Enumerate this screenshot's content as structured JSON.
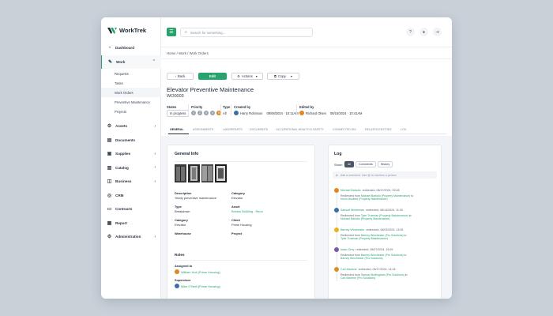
{
  "brand": {
    "name": "WorkTrek"
  },
  "sidebar": {
    "items": [
      {
        "label": "Dashboard",
        "icon": "dashboard-icon"
      },
      {
        "label": "Work",
        "icon": "wrench-icon"
      },
      {
        "label": "Assets",
        "icon": "gear-icon"
      },
      {
        "label": "Documents",
        "icon": "document-icon"
      },
      {
        "label": "Supplies",
        "icon": "box-icon"
      },
      {
        "label": "Catalog",
        "icon": "catalog-icon"
      },
      {
        "label": "Business",
        "icon": "briefcase-icon"
      },
      {
        "label": "CRM",
        "icon": "crm-icon"
      },
      {
        "label": "Contracts",
        "icon": "contract-icon"
      },
      {
        "label": "Report",
        "icon": "report-icon"
      },
      {
        "label": "Administration",
        "icon": "admin-icon"
      }
    ],
    "work_sub": [
      "Requests",
      "Tasks",
      "Work Orders",
      "Preventive Maintenance",
      "Projects"
    ]
  },
  "search": {
    "placeholder": "Search for something..."
  },
  "breadcrumb": "Home / Work / Work Orders",
  "toolbar": {
    "back": "Back",
    "edit": "Edit",
    "actions": "Actions",
    "copy": "Copy"
  },
  "page": {
    "title": "Elevator Preventive Maintenance",
    "code": "WO0003"
  },
  "meta": {
    "states_label": "States",
    "states_value": "In progress",
    "priority_label": "Priority",
    "priority_values": [
      "1",
      "2",
      "3",
      "4",
      "5"
    ],
    "priority_selected": 5,
    "type_label": "Type",
    "type_value": "All",
    "created_label": "Created by",
    "created_by": "Harry Robinson",
    "created_at": "08/08/2024 · 10:11AM",
    "edited_label": "Edited by",
    "edited_by": "Richard Olsen",
    "edited_at": "08/15/2024 · 10:41AM"
  },
  "tabs": [
    "GENERAL",
    "ASSIGNMENTS",
    "LABOR/PARTS",
    "DOCUMENTS",
    "OCCUPATIONAL HEALTH & SAFETY",
    "CONNECTED WO",
    "RELATED ENTITIES",
    "LOG"
  ],
  "general": {
    "heading": "General Info",
    "description_label": "Description",
    "description": "Yearly preventive maintenance",
    "category_label": "Category",
    "category": "Elevator",
    "type_label": "Type",
    "type": "Breakdown",
    "asset_label": "Asset",
    "asset": "Brixton Building - Reno",
    "category2_label": "Category",
    "category2": "Elevator",
    "client_label": "Client",
    "client": "Prime Housing",
    "warehouse_label": "Warehouse",
    "project_label": "Project",
    "roles_heading": "Roles",
    "assigned_label": "Assigned to",
    "assigned": "William Holt (Prime Housing)",
    "supervisor_label": "Supervisor",
    "supervisor": "Mike O'Neill (Prime Housing)"
  },
  "log": {
    "heading": "Log",
    "show_label": "Show:",
    "filters": [
      "All",
      "Comments",
      "History"
    ],
    "comment_placeholder": "Add a comment. Use @ to mention a person",
    "entries": [
      {
        "who": "Michael Bartolio",
        "when": "redirected, 08/17/2024, 09:48",
        "prefix": "Redirected from ",
        "from": "Michael Bartolio (Property Maintenance)",
        "mid": " to ",
        "to": "Kevin Wolfield (Property Maintenance)",
        "color": "#e0871e"
      },
      {
        "who": "Samuel Mesternan",
        "when": "redirected, 08/14/2024, 11:30",
        "prefix": "Redirected from ",
        "from": "Tyler Trueman (Property Maintenance)",
        "mid": " to ",
        "to": "Michael Bartolio (Property Maintenance)",
        "color": "#3b6ea8"
      },
      {
        "who": "Barney Winchester",
        "when": "redirected, 08/03/2024, 13:05",
        "prefix": "Redirected from ",
        "from": "Barney Winchester (Pro Solutions)",
        "mid": " to ",
        "to": "Tyler Trueman (Property Maintenance)",
        "color": "#e8b21c"
      },
      {
        "who": "Isaac Grey",
        "when": "redirected, 08/07/2024, 15:09",
        "prefix": "Redirected from ",
        "from": "Barney Winchester (Pro Solutions)",
        "mid": " to ",
        "to": "Barney Winchester (Pro Solutions)",
        "color": "#7a5aa8"
      },
      {
        "who": "Carl Marlene",
        "when": "redirected, 08/17/2024, 14:18",
        "prefix": "Redirected from ",
        "from": "Samuel Nottingham (Pro Solutions)",
        "mid": " to ",
        "to": "Carl Marlene (Pro Solutions)",
        "color": "#d9902a"
      }
    ]
  },
  "colors": {
    "accent": "#27a36d",
    "priority_selected": "#e0871e"
  }
}
